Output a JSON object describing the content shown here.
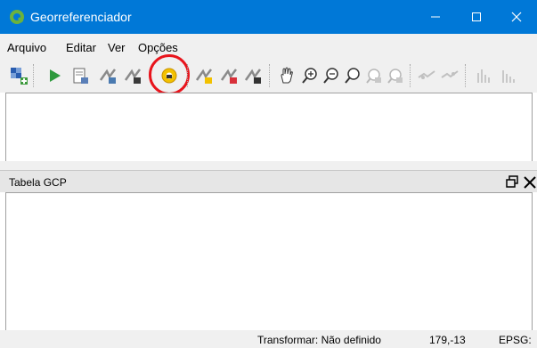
{
  "window": {
    "title": "Georreferenciador",
    "colors": {
      "titlebar": "#0078d7",
      "app_icon": "#6ab23d",
      "highlight": "#e8141c"
    }
  },
  "menu": {
    "items": [
      "Arquivo",
      "Editar",
      "Ver",
      "Opções"
    ]
  },
  "toolbar": {
    "icons": [
      "open-raster-icon",
      "start-georeferencing-icon",
      "generate-gdal-script-icon",
      "load-gcp-points-icon",
      "save-gcp-points-icon",
      "transformation-settings-icon",
      "add-point-icon",
      "delete-point-icon",
      "move-gcp-point-icon",
      "pan-icon",
      "zoom-in-icon",
      "zoom-out-icon",
      "zoom-to-layer-icon",
      "zoom-last-icon",
      "zoom-next-icon",
      "link-georeferencer-to-qgis-icon",
      "link-qgis-to-georeferencer-icon",
      "histogram-stretch-icon",
      "full-histogram-stretch-icon"
    ]
  },
  "panel": {
    "title": "Tabela GCP"
  },
  "status": {
    "transform": "Transformar: Não definido",
    "coords": "179,-13",
    "epsg": "EPSG:"
  }
}
